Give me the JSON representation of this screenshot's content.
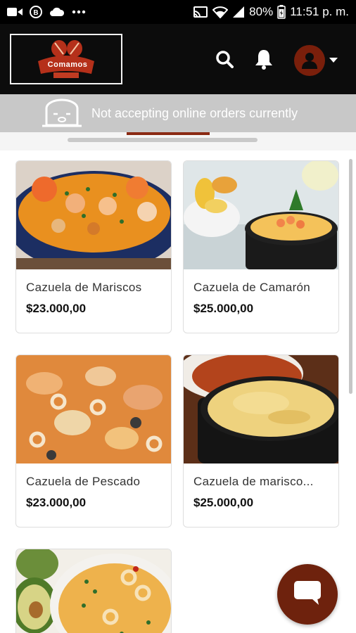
{
  "status_bar": {
    "battery": "80%",
    "time": "11:51 p. m."
  },
  "header": {
    "logo_text": "Comamos"
  },
  "banner": {
    "text": "Not accepting online orders currently"
  },
  "products": [
    {
      "name": "Cazuela de Mariscos",
      "price": "$23.000,00"
    },
    {
      "name": "Cazuela de Camarón",
      "price": "$25.000,00"
    },
    {
      "name": "Cazuela de Pescado",
      "price": "$23.000,00"
    },
    {
      "name": "Cazuela de marisco...",
      "price": "$25.000,00"
    }
  ],
  "colors": {
    "brand": "#6e220d",
    "header_bg": "#0c0c0c",
    "banner_bg": "#c8c8c8"
  },
  "icons": [
    "video-icon",
    "b-badge-icon",
    "cloud-icon",
    "more-icon",
    "cast-icon",
    "wifi-icon",
    "signal-icon",
    "battery-icon",
    "search-icon",
    "bell-icon",
    "user-icon",
    "caret-down-icon",
    "chat-icon"
  ]
}
